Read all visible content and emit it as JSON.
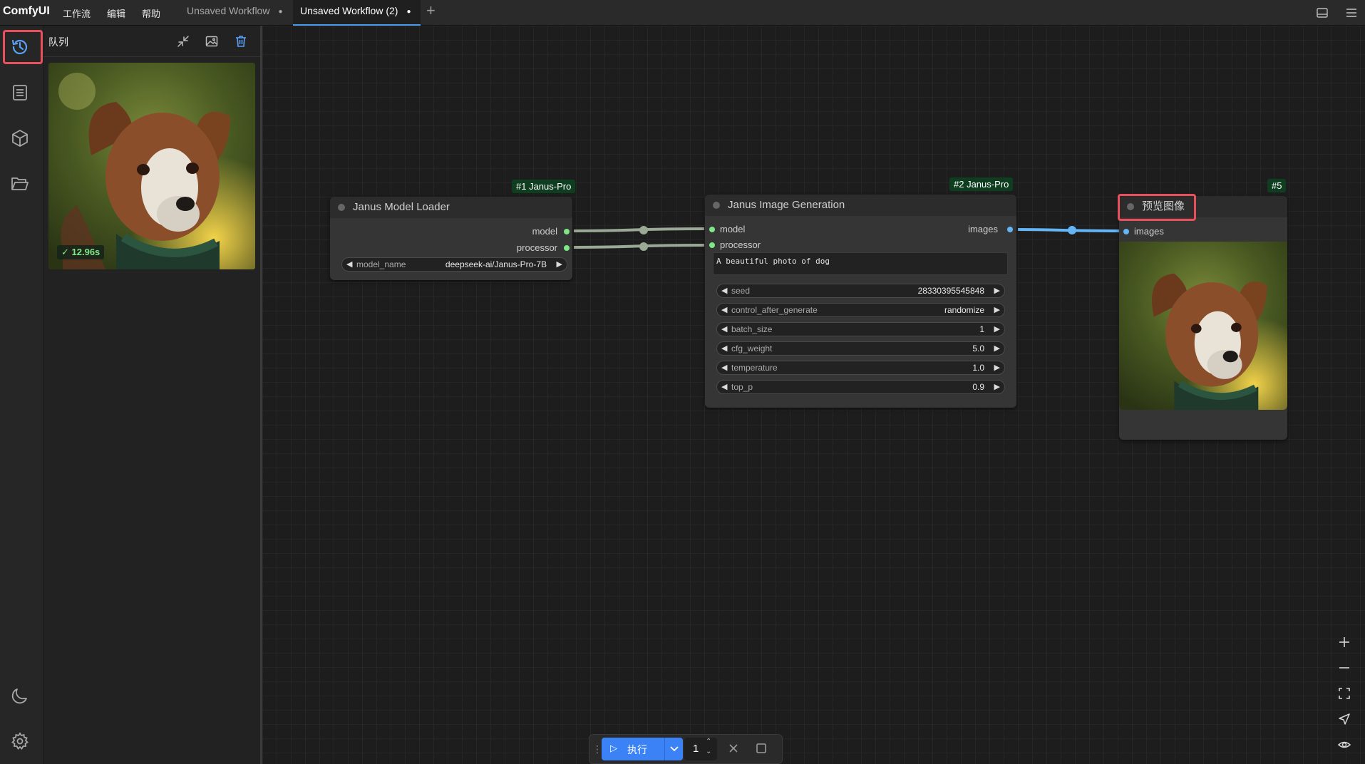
{
  "app": {
    "name": "ComfyUI"
  },
  "menu": [
    "工作流",
    "编辑",
    "帮助"
  ],
  "tabs": [
    {
      "label": "Unsaved Workflow",
      "modified": "●"
    },
    {
      "label": "Unsaved Workflow (2)",
      "modified": "●"
    }
  ],
  "queue": {
    "title": "队列",
    "item": {
      "status": "completed",
      "duration": "12.96s"
    }
  },
  "nodes": {
    "loader": {
      "badge": "#1 Janus-Pro",
      "title": "Janus Model Loader",
      "outputs": [
        "model",
        "processor"
      ],
      "widgets": {
        "model_name": {
          "label": "model_name",
          "value": "deepseek-ai/Janus-Pro-7B"
        }
      }
    },
    "generation": {
      "badge": "#2 Janus-Pro",
      "title": "Janus Image Generation",
      "inputs": [
        "model",
        "processor"
      ],
      "outputs": [
        "images"
      ],
      "prompt": "A beautiful photo of dog",
      "widgets": [
        {
          "label": "seed",
          "value": "28330395545848"
        },
        {
          "label": "control_after_generate",
          "value": "randomize"
        },
        {
          "label": "batch_size",
          "value": "1"
        },
        {
          "label": "cfg_weight",
          "value": "5.0"
        },
        {
          "label": "temperature",
          "value": "1.0"
        },
        {
          "label": "top_p",
          "value": "0.9"
        }
      ]
    },
    "preview": {
      "badge": "#5",
      "title": "预览图像",
      "inputs": [
        "images"
      ]
    }
  },
  "runbar": {
    "run_label": "执行",
    "count": "1"
  },
  "colors": {
    "accent": "#3b82f6",
    "highlight": "#e9505e",
    "badge_bg": "#0f3d1f",
    "success": "#7ee787",
    "port_green": "#7ee787",
    "port_blue": "#64b5f6"
  },
  "icons": {
    "rail": [
      "history-icon",
      "node-library-icon",
      "model-library-icon",
      "workflows-icon",
      "theme-moon-icon",
      "settings-gear-icon"
    ],
    "queue_toolbar": [
      "collapse-icon",
      "image-gallery-icon",
      "trash-icon"
    ],
    "zoom": [
      "zoom-in-icon",
      "zoom-out-icon",
      "fit-view-icon",
      "pointer-mode-icon",
      "visibility-eye-icon"
    ]
  }
}
